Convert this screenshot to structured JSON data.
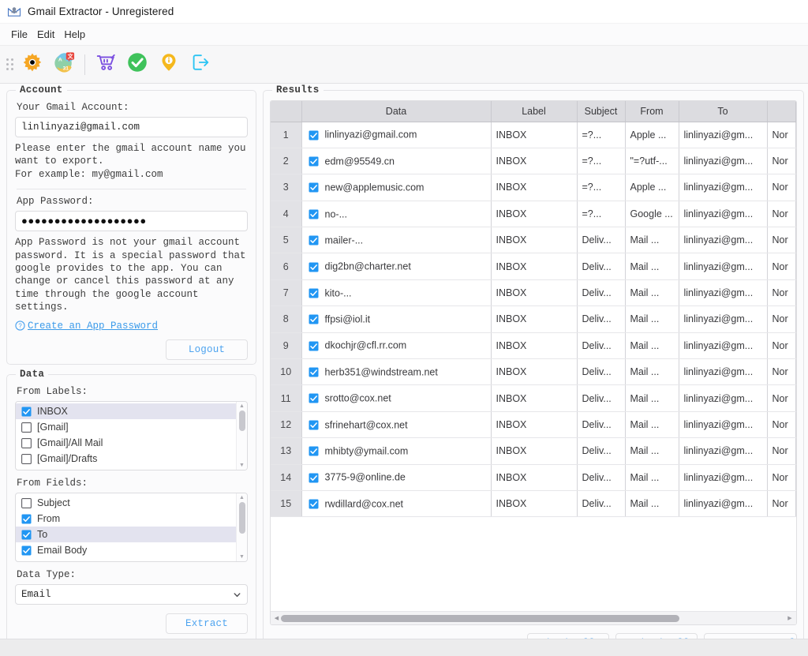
{
  "window": {
    "title": "Gmail Extractor - Unregistered",
    "app_icon": "mail-person-icon"
  },
  "menubar": {
    "items": [
      {
        "label": "File",
        "name": "menu-file"
      },
      {
        "label": "Edit",
        "name": "menu-edit"
      },
      {
        "label": "Help",
        "name": "menu-help"
      }
    ]
  },
  "toolbar": {
    "grip": "drag-grip-icon",
    "buttons": [
      {
        "name": "settings-button",
        "icon": "gear-icon",
        "tooltip": "Settings"
      },
      {
        "name": "language-button",
        "icon": "translate-icon",
        "tooltip": "Language"
      },
      {
        "name": "buy-button",
        "icon": "shopping-cart-icon",
        "tooltip": "Buy"
      },
      {
        "name": "register-button",
        "icon": "check-circle-icon",
        "tooltip": "Register"
      },
      {
        "name": "about-button",
        "icon": "info-pin-icon",
        "tooltip": "About"
      },
      {
        "name": "exit-button",
        "icon": "exit-arrow-icon",
        "tooltip": "Exit"
      }
    ]
  },
  "account": {
    "legend": "Account",
    "gmail_label": "Your Gmail Account:",
    "gmail_value": "linlinyazi@gmail.com",
    "gmail_placeholder": "my@gmail.com",
    "gmail_help": "Please enter the gmail account name you want to export.\nFor example: my@gmail.com",
    "password_label": "App Password:",
    "password_value": "●●●●●●●●●●●●●●●●●●●",
    "password_help": "App Password is not your gmail account password. It is a special password that google provides to the app. You can change or cancel this password at any time through the google account settings.",
    "create_password_link": "Create an App Password",
    "logout_label": "Logout"
  },
  "data": {
    "legend": "Data",
    "from_labels_label": "From Labels:",
    "from_labels": [
      {
        "label": "INBOX",
        "checked": true,
        "selected": true
      },
      {
        "label": "[Gmail]",
        "checked": false,
        "selected": false
      },
      {
        "label": "[Gmail]/All Mail",
        "checked": false,
        "selected": false
      },
      {
        "label": "[Gmail]/Drafts",
        "checked": false,
        "selected": false
      }
    ],
    "from_fields_label": "From Fields:",
    "from_fields": [
      {
        "label": "Subject",
        "checked": false,
        "selected": false
      },
      {
        "label": "From",
        "checked": true,
        "selected": false
      },
      {
        "label": "To",
        "checked": true,
        "selected": true
      },
      {
        "label": "Email Body",
        "checked": true,
        "selected": false
      }
    ],
    "data_type_label": "Data Type:",
    "data_type_value": "Email",
    "extract_label": "Extract"
  },
  "results": {
    "legend": "Results",
    "columns": [
      "",
      "Data",
      "Label",
      "Subject",
      "From",
      "To",
      ""
    ],
    "rows": [
      {
        "n": "1",
        "checked": true,
        "data": "linlinyazi@gmail.com",
        "label": "INBOX",
        "subject": "=?...",
        "from": "Apple ...",
        "to": "linlinyazi@gm...",
        "extra": "Nor"
      },
      {
        "n": "2",
        "checked": true,
        "data": "edm@95549.cn",
        "label": "INBOX",
        "subject": "=?...",
        "from": "\"=?utf-...",
        "to": "linlinyazi@gm...",
        "extra": "Nor"
      },
      {
        "n": "3",
        "checked": true,
        "data": "new@applemusic.com",
        "label": "INBOX",
        "subject": "=?...",
        "from": "Apple ...",
        "to": "linlinyazi@gm...",
        "extra": "Nor"
      },
      {
        "n": "4",
        "checked": true,
        "data": "no-...",
        "label": "INBOX",
        "subject": "=?...",
        "from": "Google ...",
        "to": "linlinyazi@gm...",
        "extra": "Nor"
      },
      {
        "n": "5",
        "checked": true,
        "data": "mailer-...",
        "label": "INBOX",
        "subject": "Deliv...",
        "from": "Mail ...",
        "to": "linlinyazi@gm...",
        "extra": "Nor"
      },
      {
        "n": "6",
        "checked": true,
        "data": "dig2bn@charter.net",
        "label": "INBOX",
        "subject": "Deliv...",
        "from": "Mail ...",
        "to": "linlinyazi@gm...",
        "extra": "Nor"
      },
      {
        "n": "7",
        "checked": true,
        "data": "kito-...",
        "label": "INBOX",
        "subject": "Deliv...",
        "from": "Mail ...",
        "to": "linlinyazi@gm...",
        "extra": "Nor"
      },
      {
        "n": "8",
        "checked": true,
        "data": "ffpsi@iol.it",
        "label": "INBOX",
        "subject": "Deliv...",
        "from": "Mail ...",
        "to": "linlinyazi@gm...",
        "extra": "Nor"
      },
      {
        "n": "9",
        "checked": true,
        "data": "dkochjr@cfl.rr.com",
        "label": "INBOX",
        "subject": "Deliv...",
        "from": "Mail ...",
        "to": "linlinyazi@gm...",
        "extra": "Nor"
      },
      {
        "n": "10",
        "checked": true,
        "data": "herb351@windstream.net",
        "label": "INBOX",
        "subject": "Deliv...",
        "from": "Mail ...",
        "to": "linlinyazi@gm...",
        "extra": "Nor"
      },
      {
        "n": "11",
        "checked": true,
        "data": "srotto@cox.net",
        "label": "INBOX",
        "subject": "Deliv...",
        "from": "Mail ...",
        "to": "linlinyazi@gm...",
        "extra": "Nor"
      },
      {
        "n": "12",
        "checked": true,
        "data": "sfrinehart@cox.net",
        "label": "INBOX",
        "subject": "Deliv...",
        "from": "Mail ...",
        "to": "linlinyazi@gm...",
        "extra": "Nor"
      },
      {
        "n": "13",
        "checked": true,
        "data": "mhibty@ymail.com",
        "label": "INBOX",
        "subject": "Deliv...",
        "from": "Mail ...",
        "to": "linlinyazi@gm...",
        "extra": "Nor"
      },
      {
        "n": "14",
        "checked": true,
        "data": "3775-9@online.de",
        "label": "INBOX",
        "subject": "Deliv...",
        "from": "Mail ...",
        "to": "linlinyazi@gm...",
        "extra": "Nor"
      },
      {
        "n": "15",
        "checked": true,
        "data": "rwdillard@cox.net",
        "label": "INBOX",
        "subject": "Deliv...",
        "from": "Mail ...",
        "to": "linlinyazi@gm...",
        "extra": "Nor"
      }
    ],
    "check_all_label": "Check All",
    "uncheck_all_label": "Uncheck All",
    "export_label": "Export to Excel"
  },
  "colors": {
    "accent_blue": "#4da3ef",
    "checkbox_blue": "#2196f3",
    "header_gray": "#dcdce0",
    "window_bg": "#fbfbfc"
  }
}
